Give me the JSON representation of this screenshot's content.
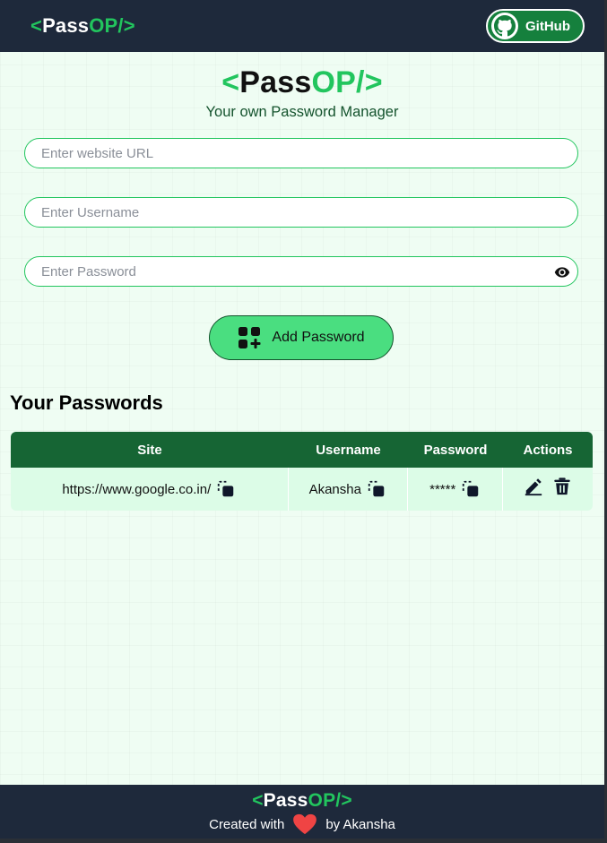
{
  "brand": {
    "lt": "<",
    "pass": "Pass",
    "op": "OP/",
    "gt": ">"
  },
  "nav": {
    "github_label": "GitHub"
  },
  "hero": {
    "subtitle": "Your own Password Manager"
  },
  "form": {
    "url_placeholder": "Enter website URL",
    "username_placeholder": "Enter Username",
    "password_placeholder": "Enter Password",
    "add_label": "Add Password"
  },
  "passwords": {
    "title": "Your Passwords",
    "headers": {
      "site": "Site",
      "username": "Username",
      "password": "Password",
      "actions": "Actions"
    },
    "rows": [
      {
        "site": "https://www.google.co.in/",
        "username": "Akansha",
        "password": "*****"
      }
    ]
  },
  "footer": {
    "created_with": "Created with",
    "by": "by Akansha"
  },
  "colors": {
    "nav_bg": "#1e293b",
    "accent": "#22c55e",
    "table_header": "#166534",
    "row_bg": "#dcfce7",
    "button_bg": "#4ade80"
  },
  "icons": [
    "github-icon",
    "eye-icon",
    "add-grid-icon",
    "copy-icon",
    "edit-icon",
    "delete-icon",
    "heart-icon"
  ]
}
